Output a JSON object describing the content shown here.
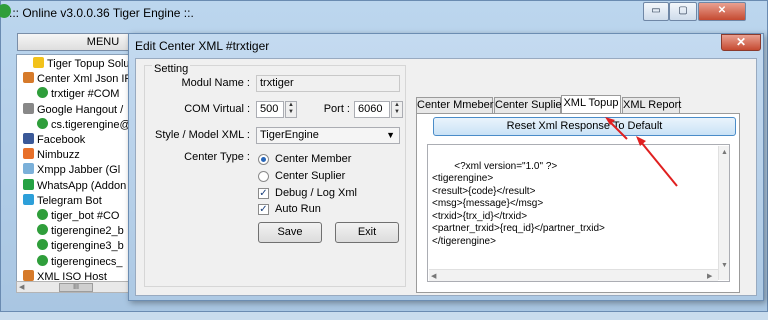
{
  "main_window": {
    "title": ".:: Online v3.0.0.36 Tiger Engine ::.",
    "minimize": "▭",
    "maximize": "▢",
    "close": "✕",
    "menu_label": "MENU"
  },
  "tree": {
    "items": [
      {
        "label": "Tiger Topup Solution",
        "icon_color": "#f2c21b",
        "icon": "star-icon"
      },
      {
        "label": "Center Xml Json IP",
        "icon_color": "#d67a2a",
        "icon": "server-icon"
      },
      {
        "label": "trxtiger #COM",
        "icon_color": "#2f9e3b",
        "icon": "play-icon"
      },
      {
        "label": "Google Hangout /",
        "icon_color": "#888888",
        "icon": "chat-icon"
      },
      {
        "label": "cs.tigerengine@",
        "icon_color": "#2f9e3b",
        "icon": "play-icon"
      },
      {
        "label": "Facebook",
        "icon_color": "#3b5998",
        "icon": "facebook-icon"
      },
      {
        "label": "Nimbuzz",
        "icon_color": "#e8702a",
        "icon": "nimbuzz-icon"
      },
      {
        "label": "Xmpp Jabber (Gl",
        "icon_color": "#7bb0d9",
        "icon": "xmpp-icon"
      },
      {
        "label": "WhatsApp (Addon",
        "icon_color": "#25a244",
        "icon": "whatsapp-icon"
      },
      {
        "label": "Telegram Bot",
        "icon_color": "#2d9fd9",
        "icon": "telegram-icon"
      },
      {
        "label": "tiger_bot #CO",
        "icon_color": "#2f9e3b",
        "icon": "play-icon"
      },
      {
        "label": "tigerengine2_b",
        "icon_color": "#2f9e3b",
        "icon": "play-icon"
      },
      {
        "label": "tigerengine3_b",
        "icon_color": "#2f9e3b",
        "icon": "play-icon"
      },
      {
        "label": "tigerenginecs_",
        "icon_color": "#2f9e3b",
        "icon": "play-icon"
      },
      {
        "label": "XML ISO Host",
        "icon_color": "#d67a2a",
        "icon": "server-icon"
      }
    ],
    "scroll_thumb": "III"
  },
  "dialog": {
    "title": "Edit Center XML #trxtiger",
    "close": "✕",
    "group_label": "Setting",
    "modul_name_label": "Modul Name :",
    "modul_name_value": "trxtiger",
    "com_virtual_label": "COM Virtual :",
    "com_virtual_value": "500",
    "port_label": "Port :",
    "port_value": "6060",
    "style_label": "Style / Model XML :",
    "style_value": "TigerEngine",
    "center_type_label": "Center Type :",
    "radio_member": "Center Member",
    "radio_suplier": "Center Suplier",
    "debug_label": "Debug / Log Xml",
    "autorun_label": "Auto Run",
    "save_label": "Save",
    "exit_label": "Exit",
    "tabs": [
      "Center Mmeber",
      "Center Suplier",
      "XML Topup",
      "XML Report"
    ],
    "active_tab": "XML Topup",
    "reset_button": "Reset Xml Response To Default",
    "xml_text": "<?xml version=\"1.0\" ?>\n<tigerengine>\n<result>{code}</result>\n<msg>{message}</msg>\n<trxid>{trx_id}</trxid>\n<partner_trxid>{req_id}</partner_trxid>\n</tigerengine>",
    "annotation_color": "#e02020"
  }
}
